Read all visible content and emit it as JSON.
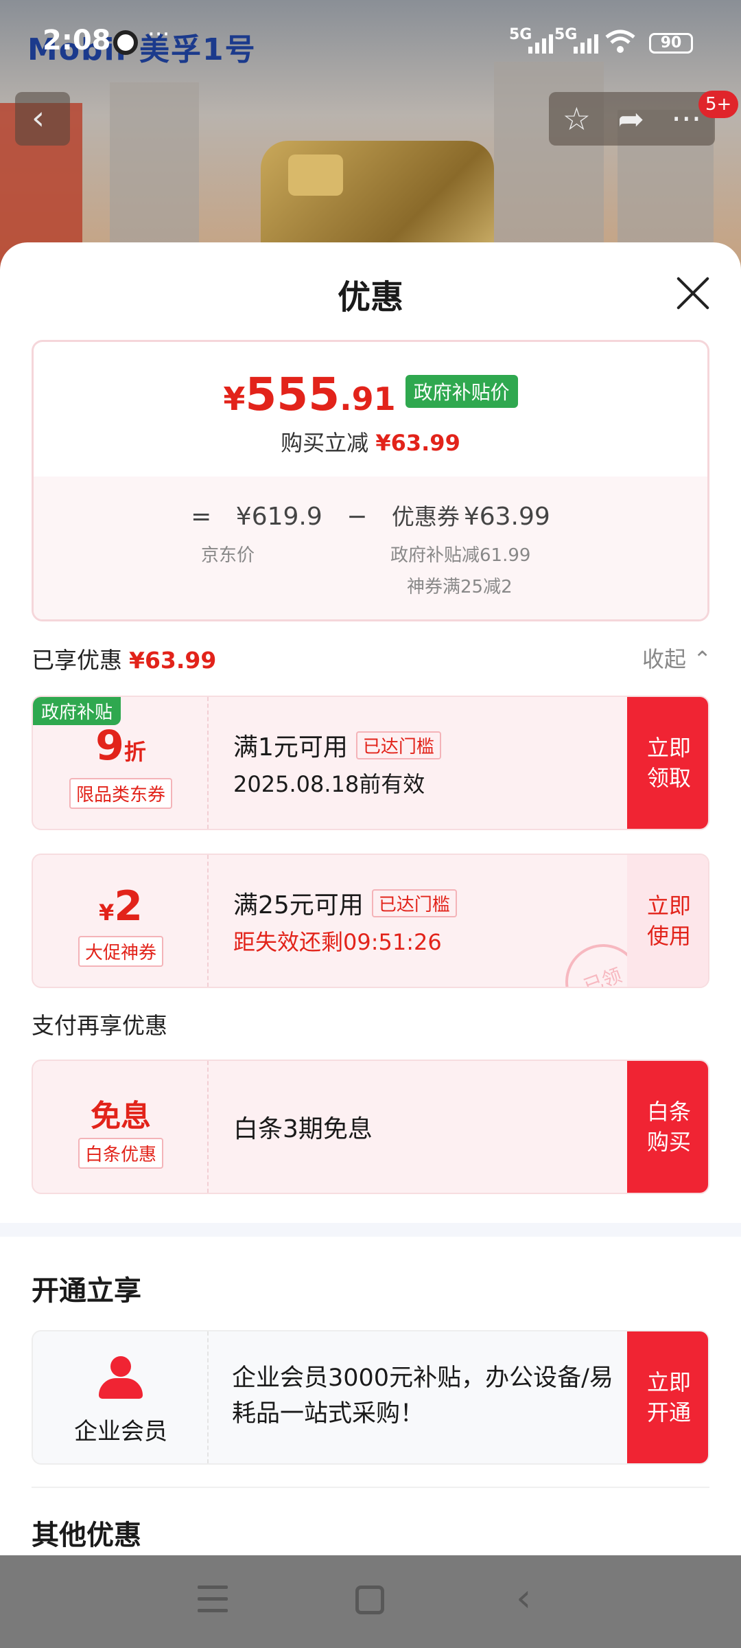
{
  "status_bar": {
    "time": "2:08",
    "net1": "5G",
    "net2": "5G",
    "battery": "90"
  },
  "background": {
    "brand": "Mobil 美孚1号",
    "badge": "5+"
  },
  "sheet": {
    "title": "优惠",
    "price": {
      "currency": "¥",
      "integer": "555",
      "decimal": ".91",
      "tag": "政府补贴价",
      "reduce_label": "购买立减",
      "reduce_value": "¥63.99",
      "eq": "=",
      "jd_price": "¥619.9",
      "minus": "−",
      "coupon_label": "优惠券",
      "coupon_value": "¥63.99",
      "jd_price_label": "京东价",
      "detail1": "政府补贴减61.99",
      "detail2": "神券满25减2"
    },
    "enjoyed": {
      "label": "已享优惠",
      "value": "¥63.99",
      "collapse": "收起"
    },
    "coupons": [
      {
        "tag": "政府补贴",
        "value": "9",
        "unit": "折",
        "type": "限品类东券",
        "condition": "满1元可用",
        "threshold": "已达门槛",
        "sub": "2025.08.18前有效",
        "action1": "立即",
        "action2": "领取"
      },
      {
        "currency": "¥",
        "value": "2",
        "type": "大促神券",
        "condition": "满25元可用",
        "threshold": "已达门槛",
        "sub": "距失效还剩09:51:26",
        "action1": "立即",
        "action2": "使用",
        "stamp": "已领"
      }
    ],
    "pay_section": {
      "title": "支付再享优惠",
      "value": "免息",
      "type": "白条优惠",
      "desc": "白条3期免息",
      "action1": "白条",
      "action2": "购买"
    },
    "open_section": {
      "title": "开通立享",
      "label": "企业会员",
      "desc": "企业会员3000元补贴，办公设备/易耗品一站式采购！",
      "action1": "立即",
      "action2": "开通"
    },
    "other_title": "其他优惠"
  },
  "colors": {
    "accent": "#f02433",
    "price_red": "#e2231a",
    "gov_green": "#2fa84f"
  }
}
